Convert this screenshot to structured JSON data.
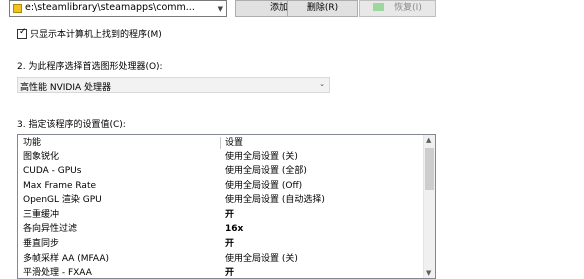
{
  "program_selector": {
    "path": "e:\\steamlibrary\\steamapps\\comm...",
    "add_label": "添加(D)",
    "remove_label": "删除(R)",
    "restore_label": "恢复(I)"
  },
  "checkbox": {
    "label": "只显示本计算机上找到的程序(M)",
    "checked": true
  },
  "section2": {
    "label": "2. 为此程序选择首选图形处理器(O):",
    "selected": "高性能 NVIDIA 处理器"
  },
  "section3": {
    "label": "3. 指定该程序的设置值(C):",
    "headers": {
      "feature": "功能",
      "setting": "设置"
    },
    "rows": [
      {
        "feature": "图象锐化",
        "setting": "使用全局设置 (关)"
      },
      {
        "feature": "CUDA - GPUs",
        "setting": "使用全局设置 (全部)"
      },
      {
        "feature": "Max Frame Rate",
        "setting": "使用全局设置 (Off)"
      },
      {
        "feature": "OpenGL 渲染 GPU",
        "setting": "使用全局设置 (自动选择)"
      },
      {
        "feature": "三重缓冲",
        "setting": "开"
      },
      {
        "feature": "各向异性过滤",
        "setting": "16x"
      },
      {
        "feature": "垂直同步",
        "setting": "开"
      },
      {
        "feature": "多帧采样 AA (MFAA)",
        "setting": "使用全局设置 (关)"
      },
      {
        "feature": "平滑处理 - FXAA",
        "setting": "开"
      }
    ]
  }
}
